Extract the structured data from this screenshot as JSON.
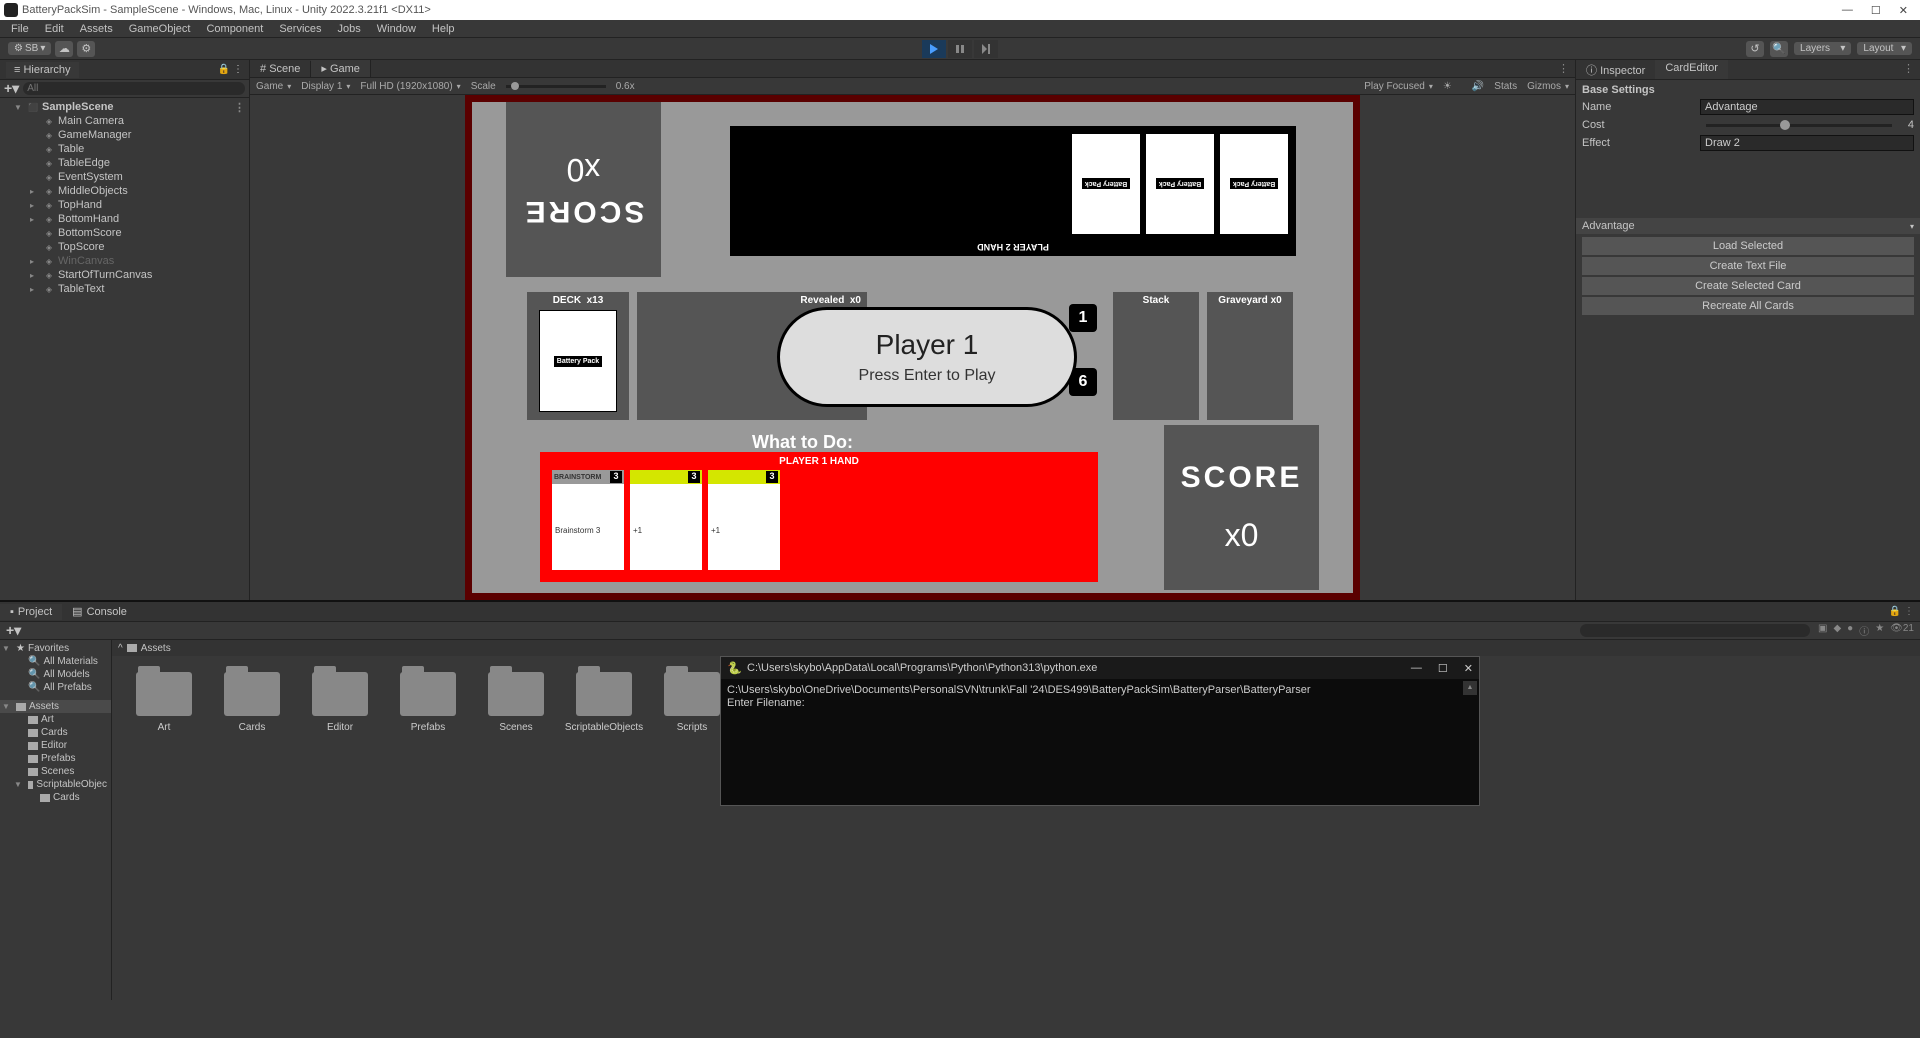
{
  "window": {
    "title": "BatteryPackSim - SampleScene - Windows, Mac, Linux - Unity 2022.3.21f1 <DX11>"
  },
  "menubar": [
    "File",
    "Edit",
    "Assets",
    "GameObject",
    "Component",
    "Services",
    "Jobs",
    "Window",
    "Help"
  ],
  "toolbar": {
    "account": "SB",
    "layers": "Layers",
    "layout": "Layout"
  },
  "hierarchy": {
    "tab": "Hierarchy",
    "search_placeholder": "All",
    "scene": "SampleScene",
    "items": [
      {
        "name": "Main Camera",
        "expandable": false
      },
      {
        "name": "GameManager",
        "expandable": false
      },
      {
        "name": "Table",
        "expandable": false
      },
      {
        "name": "TableEdge",
        "expandable": false
      },
      {
        "name": "EventSystem",
        "expandable": false
      },
      {
        "name": "MiddleObjects",
        "expandable": true
      },
      {
        "name": "TopHand",
        "expandable": true
      },
      {
        "name": "BottomHand",
        "expandable": true
      },
      {
        "name": "BottomScore",
        "expandable": false
      },
      {
        "name": "TopScore",
        "expandable": false
      },
      {
        "name": "WinCanvas",
        "expandable": true,
        "dim": true
      },
      {
        "name": "StartOfTurnCanvas",
        "expandable": true
      },
      {
        "name": "TableText",
        "expandable": true
      }
    ]
  },
  "gametabs": {
    "scene": "Scene",
    "game": "Game"
  },
  "gametoolbar": {
    "game": "Game",
    "display": "Display 1",
    "resolution": "Full HD (1920x1080)",
    "scale_label": "Scale",
    "scale_value": "0.6x",
    "play_focused": "Play Focused",
    "stats": "Stats",
    "gizmos": "Gizmos"
  },
  "game": {
    "score_label": "SCORE",
    "score_top_val": "x0",
    "score_bot_val": "x0",
    "p2hand_label": "PLAYER 2 HAND",
    "p2card_label": "Battery Pack",
    "deck_label": "DECK",
    "deck_count": "x13",
    "deck_card": "Battery Pack",
    "revealed_label": "Revealed",
    "revealed_count": "x0",
    "stack_label": "Stack",
    "graveyard_label": "Graveyard",
    "graveyard_count": "x0",
    "turn_badge1": "1",
    "turn_badge2": "6",
    "dialog_title": "Player 1",
    "dialog_sub": "Press Enter to Play",
    "whattodo": "What to Do:",
    "p1hand_label": "PLAYER 1 HAND",
    "p1cards": [
      {
        "name": "BRAINSTORM",
        "cost": "3",
        "desc": "Brainstorm 3",
        "top": "gray"
      },
      {
        "name": "",
        "cost": "3",
        "desc": "+1",
        "top": "yellow"
      },
      {
        "name": "",
        "cost": "3",
        "desc": "+1",
        "top": "yellow"
      }
    ]
  },
  "inspector": {
    "tabs": {
      "inspector": "Inspector",
      "cardeditor": "CardEditor"
    },
    "section": "Base Settings",
    "name_label": "Name",
    "name_value": "Advantage",
    "cost_label": "Cost",
    "cost_value": "4",
    "effect_label": "Effect",
    "effect_value": "Draw 2",
    "dropdown": "Advantage",
    "buttons": [
      "Load Selected",
      "Create Text File",
      "Create Selected Card",
      "Recreate All Cards"
    ]
  },
  "project": {
    "tabs": {
      "project": "Project",
      "console": "Console"
    },
    "hidden_count": "21",
    "breadcrumb": "Assets",
    "tree": {
      "favorites": "Favorites",
      "fav_items": [
        "All Materials",
        "All Models",
        "All Prefabs"
      ],
      "assets": "Assets",
      "asset_items": [
        "Art",
        "Cards",
        "Editor",
        "Prefabs",
        "Scenes"
      ],
      "scriptable": "ScriptableObjec",
      "scriptable_items": [
        "Cards"
      ]
    },
    "folders": [
      "Art",
      "Cards",
      "Editor",
      "Prefabs",
      "Scenes",
      "ScriptableObjects",
      "Scripts"
    ]
  },
  "terminal": {
    "title": "C:\\Users\\skybo\\AppData\\Local\\Programs\\Python\\Python313\\python.exe",
    "line1": "C:\\Users\\skybo\\OneDrive\\Documents\\PersonalSVN\\trunk\\Fall '24\\DES499\\BatteryPackSim\\BatteryParser\\BatteryParser",
    "line2": "Enter Filename:"
  }
}
